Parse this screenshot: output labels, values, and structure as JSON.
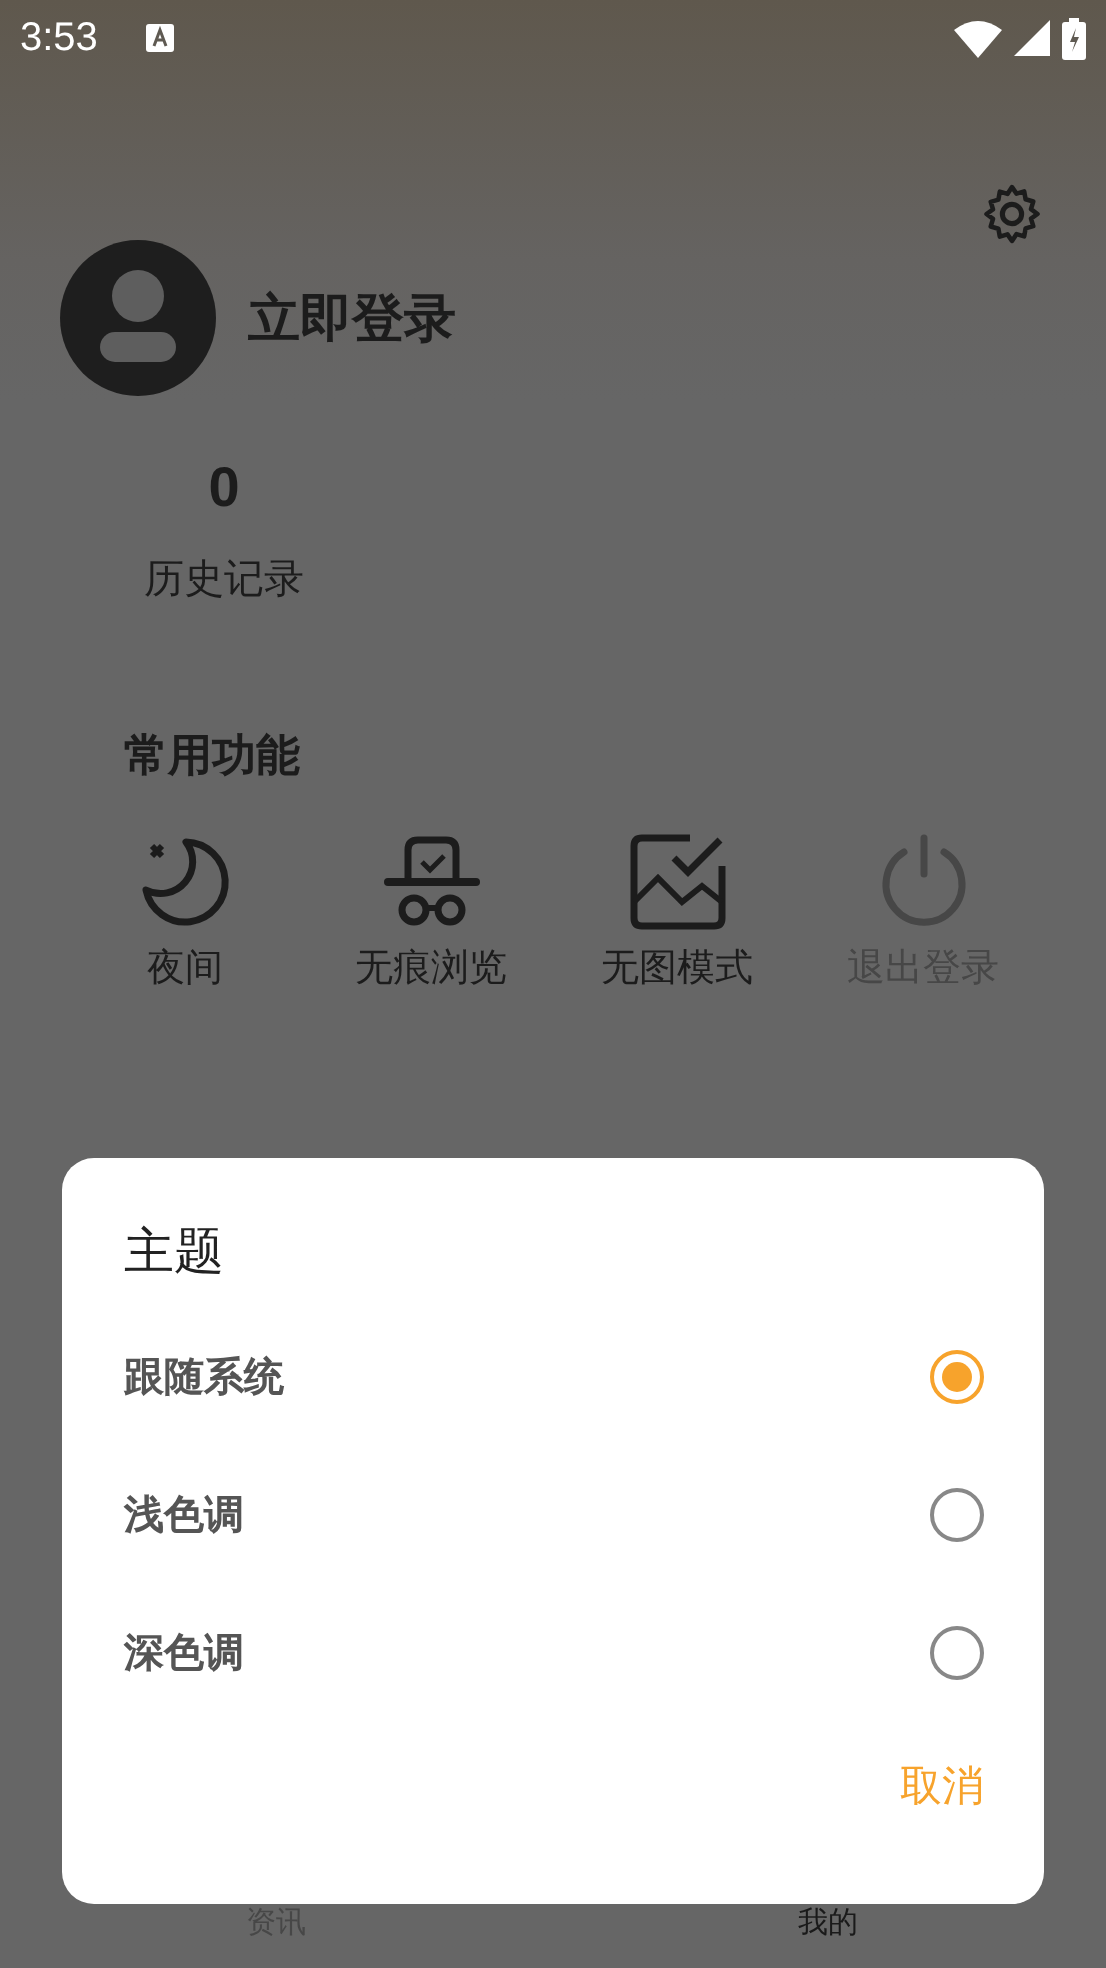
{
  "status_bar": {
    "time": "3:53"
  },
  "profile": {
    "login_label": "立即登录"
  },
  "stats": [
    {
      "value": "0",
      "label": "历史记录"
    }
  ],
  "section": {
    "title": "常用功能"
  },
  "functions": [
    {
      "kind": "night",
      "label": "夜间",
      "disabled": false
    },
    {
      "kind": "incognito",
      "label": "无痕浏览",
      "disabled": false
    },
    {
      "kind": "no_image",
      "label": "无图模式",
      "disabled": false
    },
    {
      "kind": "logout",
      "label": "退出登录",
      "disabled": true
    }
  ],
  "dialog": {
    "title": "主题",
    "options": [
      {
        "label": "跟随系统",
        "selected": true
      },
      {
        "label": "浅色调",
        "selected": false
      },
      {
        "label": "深色调",
        "selected": false
      }
    ],
    "cancel": "取消"
  },
  "bottom_nav": [
    {
      "label": "资讯",
      "selected": false
    },
    {
      "label": "我的",
      "selected": true
    }
  ]
}
